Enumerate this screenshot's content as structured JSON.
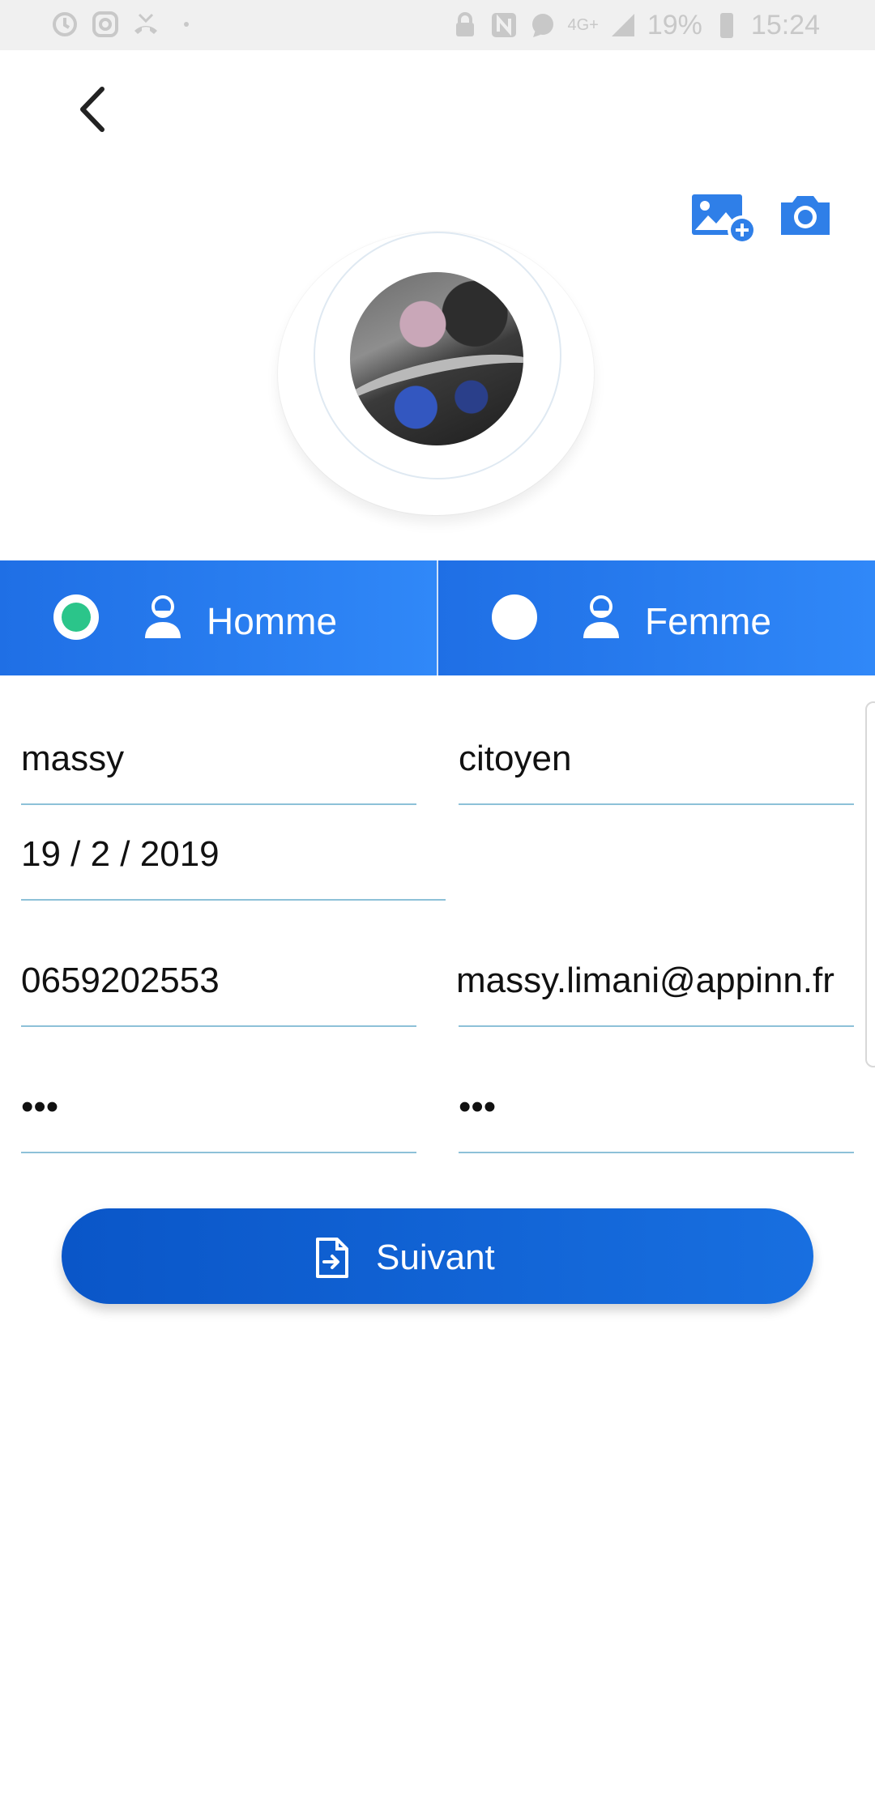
{
  "status_bar": {
    "battery": "19%",
    "time": "15:24",
    "network": "4G+",
    "left_icons": [
      "sync-icon",
      "instagram-icon",
      "missed-call-icon",
      "dot-icon"
    ],
    "right_icons": [
      "lock-icon",
      "nfc-icon",
      "whatsapp-icon",
      "signal-icon",
      "battery-icon"
    ]
  },
  "header": {
    "back_icon": "chevron-left-icon",
    "gallery_icon": "add-image-icon",
    "camera_icon": "camera-icon"
  },
  "gender": {
    "options": [
      {
        "label": "Homme",
        "selected": true
      },
      {
        "label": "Femme",
        "selected": false
      }
    ],
    "accent": "#2f84f5",
    "selected_color": "#2bc58a"
  },
  "form": {
    "first_name": "massy",
    "last_name": "citoyen",
    "birth_date": "19 / 2 / 2019",
    "phone": "0659202553",
    "email": "massy.limani@appinn.fr",
    "password": "•••",
    "password_confirm": "•••"
  },
  "next_button": {
    "label": "Suivant",
    "icon": "file-arrow-icon"
  }
}
